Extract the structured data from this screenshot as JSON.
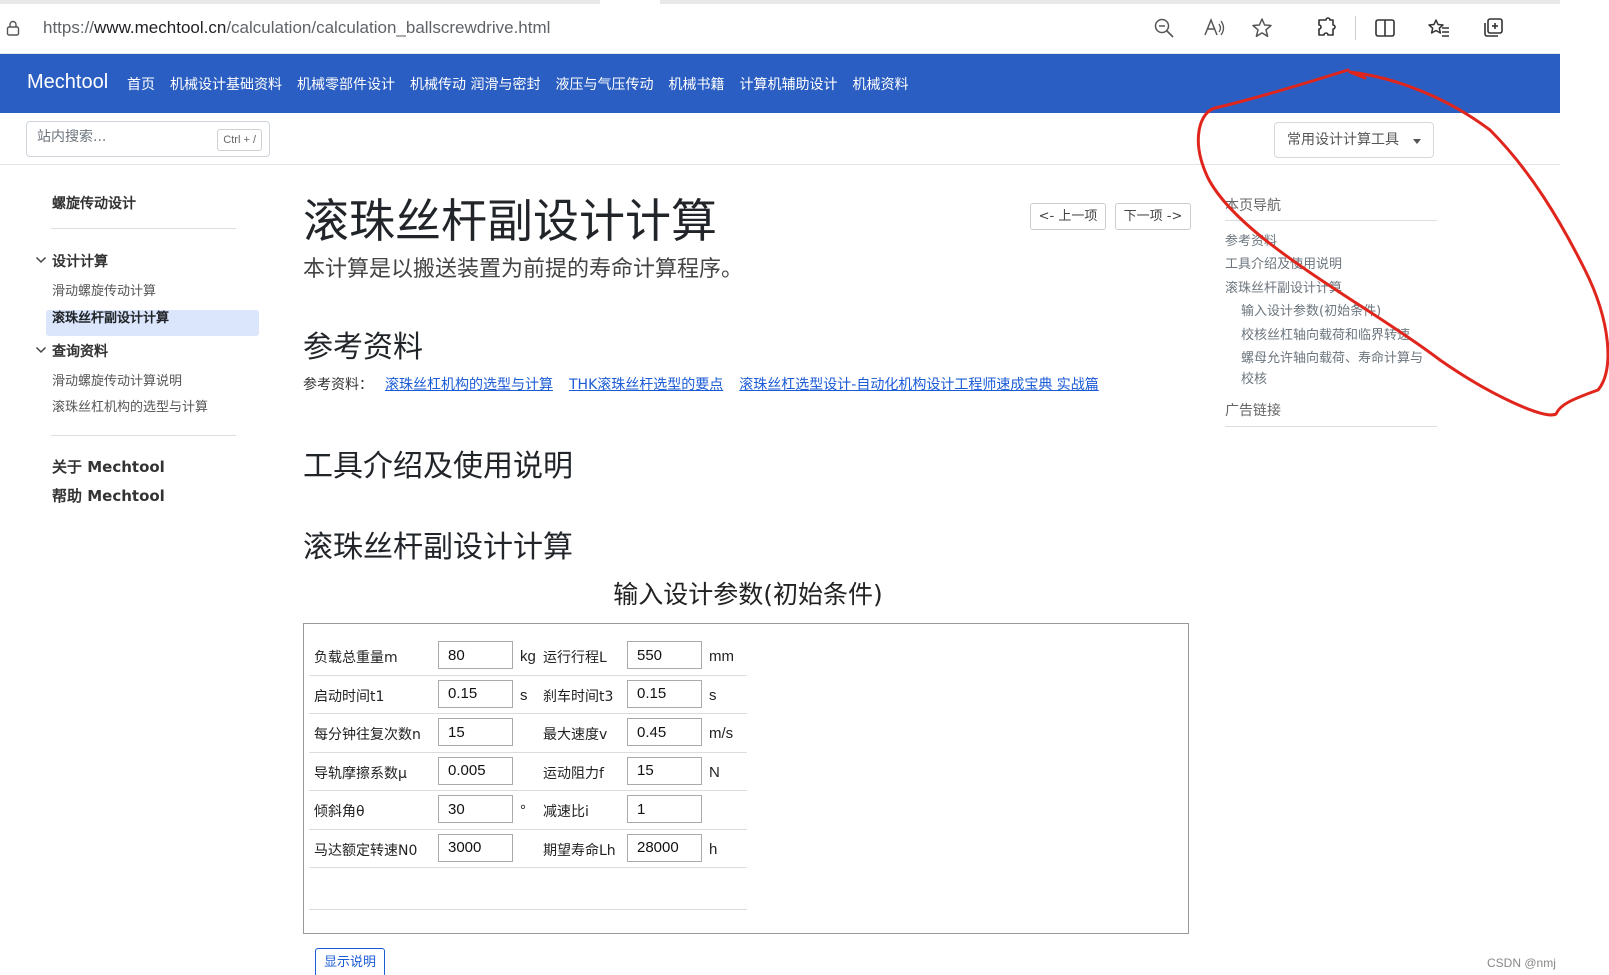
{
  "browser": {
    "url_scheme": "https://",
    "url_host": "www.mechtool.cn",
    "url_path": "/calculation/calculation_ballscrewdrive.html",
    "icons": [
      "lock-icon",
      "zoom-out-icon",
      "read-aloud-icon",
      "favorite-star-icon",
      "extensions-icon",
      "split-screen-icon",
      "favorites-icon",
      "collections-icon"
    ]
  },
  "navbar": {
    "brand": "Mechtool",
    "links": [
      "首页",
      "机械设计基础资料",
      "机械零部件设计",
      "机械传动 润滑与密封",
      "液压与气压传动",
      "机械书籍",
      "计算机辅助设计",
      "机械资料"
    ],
    "color": "#2b5ec2"
  },
  "subbar": {
    "search_placeholder": "站内搜索...",
    "search_shortcut": "Ctrl + /",
    "tools_dropdown": "常用设计计算工具"
  },
  "sidebar": {
    "section_title": "螺旋传动设计",
    "group1": {
      "title": "设计计算",
      "items": [
        "滑动螺旋传动计算",
        "滚珠丝杆副设计计算"
      ]
    },
    "group2": {
      "title": "查询资料",
      "items": [
        "滑动螺旋传动计算说明",
        "滚珠丝杠机构的选型与计算"
      ]
    },
    "footer": [
      "关于 Mechtool",
      "帮助 Mechtool"
    ]
  },
  "main": {
    "title": "滚珠丝杆副设计计算",
    "lead": "本计算是以搬送装置为前提的寿命计算程序。",
    "prev": "<- 上一项",
    "next": "下一项 ->",
    "refs_heading": "参考资料",
    "refs_label": "参考资料：",
    "refs": [
      "滚珠丝杠机构的选型与计算",
      "THK滚珠丝杆选型的要点",
      "滚珠丝杠选型设计-自动化机构设计工程师速成宝典 实战篇"
    ],
    "intro_heading": "工具介绍及使用说明",
    "calc_heading": "滚珠丝杆副设计计算",
    "form_caption": "输入设计参数(初始条件)",
    "rows": [
      {
        "l_label": "负载总重量m",
        "l_value": "80",
        "l_unit": "kg",
        "r_label": "运行行程L",
        "r_value": "550",
        "r_unit": "mm"
      },
      {
        "l_label": "启动时间t1",
        "l_value": "0.15",
        "l_unit": "s",
        "r_label": "刹车时间t3",
        "r_value": "0.15",
        "r_unit": "s"
      },
      {
        "l_label": "每分钟往复次数n",
        "l_value": "15",
        "l_unit": "",
        "r_label": "最大速度v",
        "r_value": "0.45",
        "r_unit": "m/s"
      },
      {
        "l_label": "导轨摩擦系数μ",
        "l_value": "0.005",
        "l_unit": "",
        "r_label": "运动阻力f",
        "r_value": "15",
        "r_unit": "N"
      },
      {
        "l_label": "倾斜角θ",
        "l_value": "30",
        "l_unit": "°",
        "r_label": "减速比i",
        "r_value": "1",
        "r_unit": ""
      },
      {
        "l_label": "马达额定转速N0",
        "l_value": "3000",
        "l_unit": "",
        "r_label": "期望寿命Lh",
        "r_value": "28000",
        "r_unit": "h"
      }
    ],
    "explain_button": "显示说明"
  },
  "toc": {
    "heading": "本页导航",
    "items": [
      "参考资料",
      "工具介绍及使用说明",
      "滚珠丝杆副设计计算"
    ],
    "subitems": [
      "输入设计参数(初始条件)",
      "校核丝杠轴向载荷和临界转速",
      "螺母允许轴向载荷、寿命计算与",
      "校核"
    ],
    "ads": "广告链接"
  },
  "watermark": "CSDN @nmj",
  "annotation_color": "#e0261c"
}
